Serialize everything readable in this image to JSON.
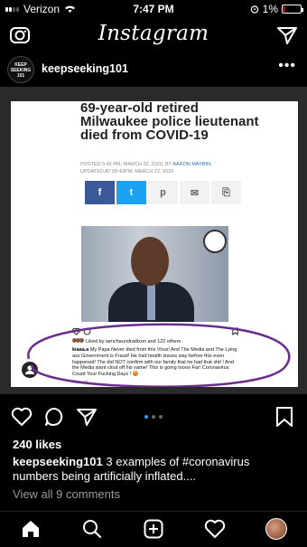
{
  "status": {
    "carrier": "Verizon",
    "time": "7:47 PM",
    "battery": "1%"
  },
  "header": {
    "title": "Instagram"
  },
  "post": {
    "avatar_text": "KEEP SEEKING 101",
    "username": "keepseeking101",
    "more": "•••",
    "likes": "240 likes",
    "caption_user": "keepseeking101",
    "caption_text": "3 examples of #coronavirus numbers being artificially inflated....",
    "view_comments": "View all 9 comments",
    "carousel": {
      "count": 3,
      "active": 0
    }
  },
  "article": {
    "headline": "69-year-old retired Milwaukee police lieutenant died from COVID-19",
    "posted": "POSTED 5:42 PM, MARCH 22, 2020, BY",
    "author": "AARON MAYBIN",
    "updated": "UPDATED AT 06:43PM, MARCH 22, 2020",
    "share_buttons": [
      "f",
      "t",
      "p",
      "✉",
      "⎘"
    ]
  },
  "embedded_ig": {
    "liked_by": "Liked by iamchaundradixon and 122 others",
    "comment_user": "kiaaa.a",
    "comment_text": "My Papa Never died from this Virus! And The Media and The Lying ass Government is Fraud! He had health issues way before this even happened! The did NOT confirm with our family that he had that shit ! And the Media want clout off his name! This is going toooo Far! Coronavirus Count Your Fucking Days ! 😡",
    "view_all": "View all"
  },
  "colors": {
    "accent": "#3897f0",
    "circle": "#6b2d8c"
  }
}
